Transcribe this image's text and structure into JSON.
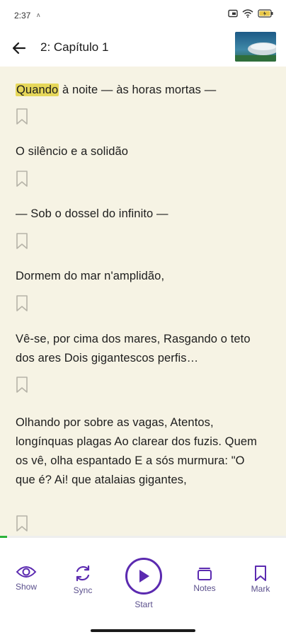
{
  "status": {
    "time": "2:37",
    "small_mark": "ʌ",
    "icons": [
      "cast-icon",
      "wifi-icon",
      "battery-icon"
    ]
  },
  "header": {
    "title": "2: Capítulo 1",
    "back_icon": "arrow-left-icon"
  },
  "reader": {
    "highlight_word": "Quando",
    "paragraphs": [
      " à noite — às horas mortas —",
      "O silêncio e a solidão",
      "— Sob o dossel do infinito —",
      "Dormem do mar n'amplidão,",
      "Vê-se, por cima dos mares, Rasgando o teto dos ares Dois gigantescos perfis…",
      "Olhando por sobre as vagas, Atentos, longínquas plagas Ao clarear dos fuzis. Quem os vê, olha espantado E a sós murmura: \"O que é? Ai! que atalaias gigantes,"
    ],
    "background": "#f6f3e4",
    "highlight_color": "#e6d75a"
  },
  "progress": {
    "fraction": 0.025,
    "color": "#2bb23a"
  },
  "bottom_nav": {
    "accent": "#5b2ab0",
    "show": "Show",
    "sync": "Sync",
    "start": "Start",
    "notes": "Notes",
    "mark": "Mark"
  }
}
